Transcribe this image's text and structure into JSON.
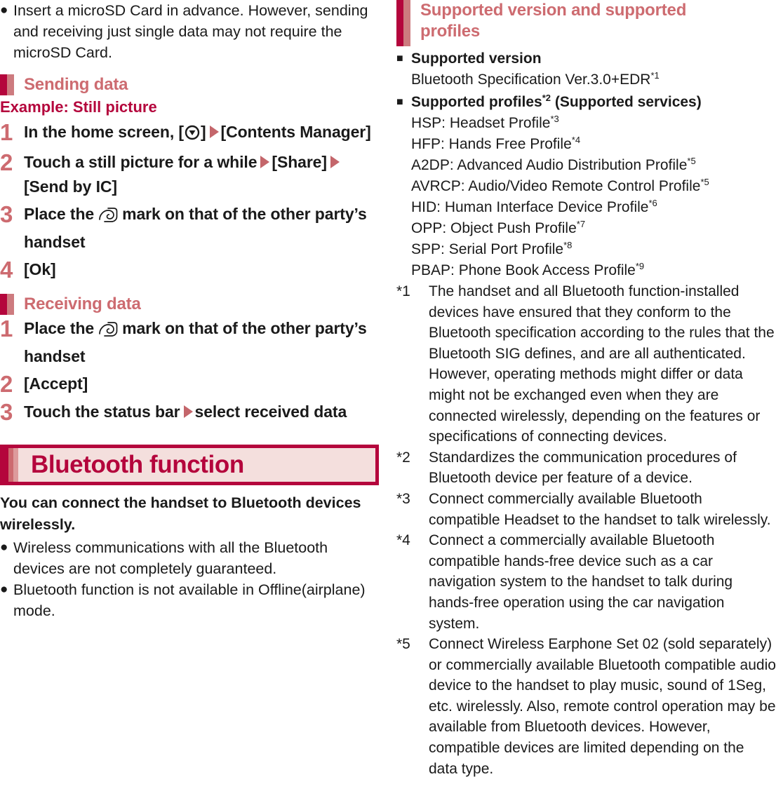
{
  "left": {
    "intro_bullets": [
      {
        "marker": "●",
        "text": "Insert a microSD Card in advance. However, sending and receiving just single data may not require the microSD Card."
      }
    ],
    "sending": {
      "heading": "Sending data",
      "example_label": "Example: Still picture",
      "steps": [
        {
          "num": "1",
          "parts": [
            {
              "type": "text",
              "value": "In the home screen, ["
            },
            {
              "type": "icon",
              "value": "app-drawer-icon"
            },
            {
              "type": "text",
              "value": "]"
            },
            {
              "type": "arrow",
              "value": "▶"
            },
            {
              "type": "text",
              "value": "[Contents Manager]"
            }
          ],
          "plain": "In the home screen, [⊙] ▶ [Contents Manager]"
        },
        {
          "num": "2",
          "parts": [
            {
              "type": "text",
              "value": "Touch a still picture for a while"
            },
            {
              "type": "arrow",
              "value": "▶"
            },
            {
              "type": "text",
              "value": "[Share]"
            },
            {
              "type": "arrow",
              "value": "▶"
            },
            {
              "type": "text",
              "value": "[Send by IC]"
            }
          ],
          "plain": "Touch a still picture for a while ▶ [Share] ▶ [Send by IC]"
        },
        {
          "num": "3",
          "parts": [
            {
              "type": "text",
              "value": "Place the"
            },
            {
              "type": "icon",
              "value": "nfc-mark-icon"
            },
            {
              "type": "text",
              "value": "mark on that of the other party’s handset"
            }
          ],
          "plain": "Place the ⌐ mark on that of the other party’s handset"
        },
        {
          "num": "4",
          "parts": [
            {
              "type": "text",
              "value": "[Ok]"
            }
          ],
          "plain": "[Ok]"
        }
      ]
    },
    "receiving": {
      "heading": "Receiving data",
      "steps": [
        {
          "num": "1",
          "parts": [
            {
              "type": "text",
              "value": "Place the"
            },
            {
              "type": "icon",
              "value": "nfc-mark-icon"
            },
            {
              "type": "text",
              "value": "mark on that of the other party’s handset"
            }
          ],
          "plain": "Place the ⌐ mark on that of the other party’s handset"
        },
        {
          "num": "2",
          "parts": [
            {
              "type": "text",
              "value": "[Accept]"
            }
          ],
          "plain": "[Accept]"
        },
        {
          "num": "3",
          "parts": [
            {
              "type": "text",
              "value": "Touch the status bar"
            },
            {
              "type": "arrow",
              "value": "▶"
            },
            {
              "type": "text",
              "value": "select received data"
            }
          ],
          "plain": "Touch the status bar ▶ select received data"
        }
      ]
    },
    "bluetooth": {
      "banner_title": "Bluetooth function",
      "lead": "You can connect the handset to Bluetooth devices wirelessly.",
      "bullets": [
        {
          "marker": "●",
          "text": "Wireless communications with all the Bluetooth devices are not completely guaranteed."
        },
        {
          "marker": "●",
          "text": "Bluetooth function is not available in Offline(airplane) mode."
        }
      ]
    }
  },
  "right": {
    "heading": "Supported version and supported profiles",
    "supported_version": {
      "marker": "■",
      "label": "Supported version",
      "value": "Bluetooth Specification Ver.3.0+EDR",
      "value_sup": "*1"
    },
    "supported_profiles": {
      "marker": "■",
      "label_pre": "Supported profiles",
      "label_sup": "*2",
      "label_post": " (Supported services)",
      "items": [
        {
          "text": "HSP: Headset Profile",
          "sup": "*3"
        },
        {
          "text": "HFP: Hands Free Profile",
          "sup": "*4"
        },
        {
          "text": "A2DP: Advanced Audio Distribution Profile",
          "sup": "*5"
        },
        {
          "text": "AVRCP: Audio/Video Remote Control Profile",
          "sup": "*5"
        },
        {
          "text": "HID: Human Interface Device Profile",
          "sup": "*6"
        },
        {
          "text": "OPP: Object Push Profile",
          "sup": "*7"
        },
        {
          "text": "SPP: Serial Port Profile",
          "sup": "*8"
        },
        {
          "text": "PBAP: Phone Book Access Profile",
          "sup": "*9"
        }
      ]
    },
    "footnotes": [
      {
        "mark": "*1",
        "text": "The handset and all Bluetooth function-installed devices have ensured that they conform to the Bluetooth specification according to the rules that the Bluetooth SIG defines, and are all authenticated. However, operating methods might differ or data might not be exchanged even when they are connected wirelessly, depending on the features or specifications of connecting devices."
      },
      {
        "mark": "*2",
        "text": "Standardizes the communication procedures of Bluetooth device per feature of a device."
      },
      {
        "mark": "*3",
        "text": "Connect commercially available Bluetooth compatible Headset to the handset to talk wirelessly."
      },
      {
        "mark": "*4",
        "text": "Connect a commercially available Bluetooth compatible hands-free device such as a car navigation system to the handset to talk during hands-free operation using the car navigation system."
      },
      {
        "mark": "*5",
        "text": "Connect Wireless Earphone Set 02 (sold separately) or commercially available Bluetooth compatible audio device to the handset to play music, sound of 1Seg, etc. wirelessly. Also, remote control operation may be available from Bluetooth devices. However, compatible devices are limited depending on the data type."
      }
    ]
  },
  "colors": {
    "crimson": "#b4053c",
    "rose": "#cd6b70",
    "banner_fill": "#f4dfdd",
    "text": "#1a1a1a"
  }
}
